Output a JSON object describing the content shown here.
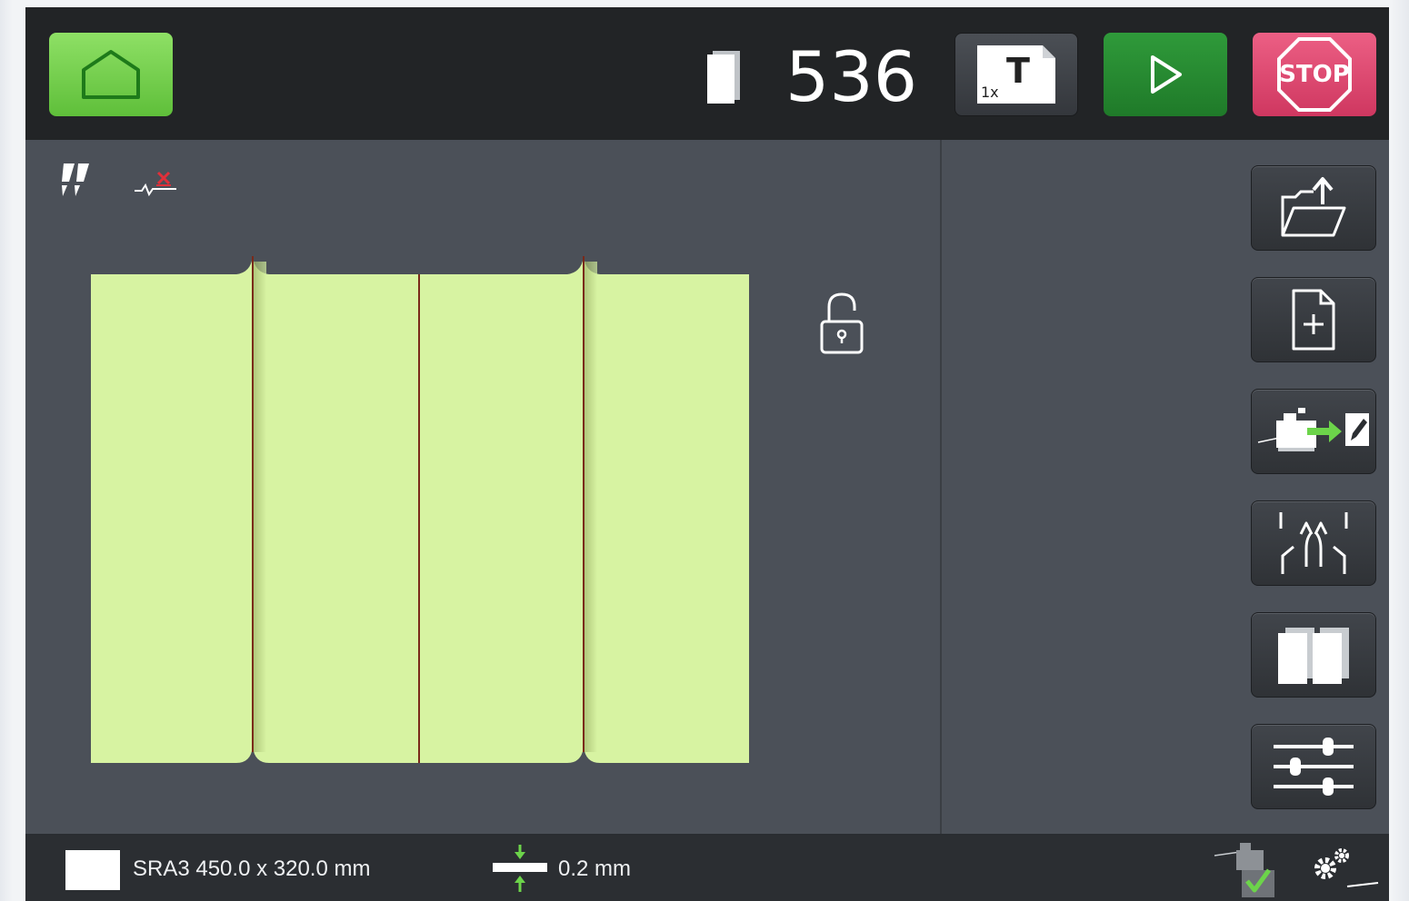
{
  "header": {
    "home_label": "",
    "counter": "536",
    "mode_badge": "1x",
    "mode_letter": "T",
    "stop_label": "STOP"
  },
  "status": {
    "paper": "SRA3 450.0 x 320.0 mm",
    "gap": "0.2 mm"
  },
  "icons": {
    "home": "home-icon",
    "counter": "sheet-stack-icon",
    "mode": "single-sheet-T-icon",
    "start": "play-icon",
    "stop": "stop-sign-icon",
    "lock": "unlocked-padlock-icon",
    "side": [
      "open-folder-icon",
      "new-document-icon",
      "machine-transfer-edit-icon",
      "split-arrows-icon",
      "pages-icon",
      "sliders-icon"
    ]
  },
  "colors": {
    "sheet": "#d7f3a2",
    "crease": "#7a2a1a",
    "start": "#2a8f35",
    "stop": "#e04570",
    "home": "#7cd356"
  }
}
